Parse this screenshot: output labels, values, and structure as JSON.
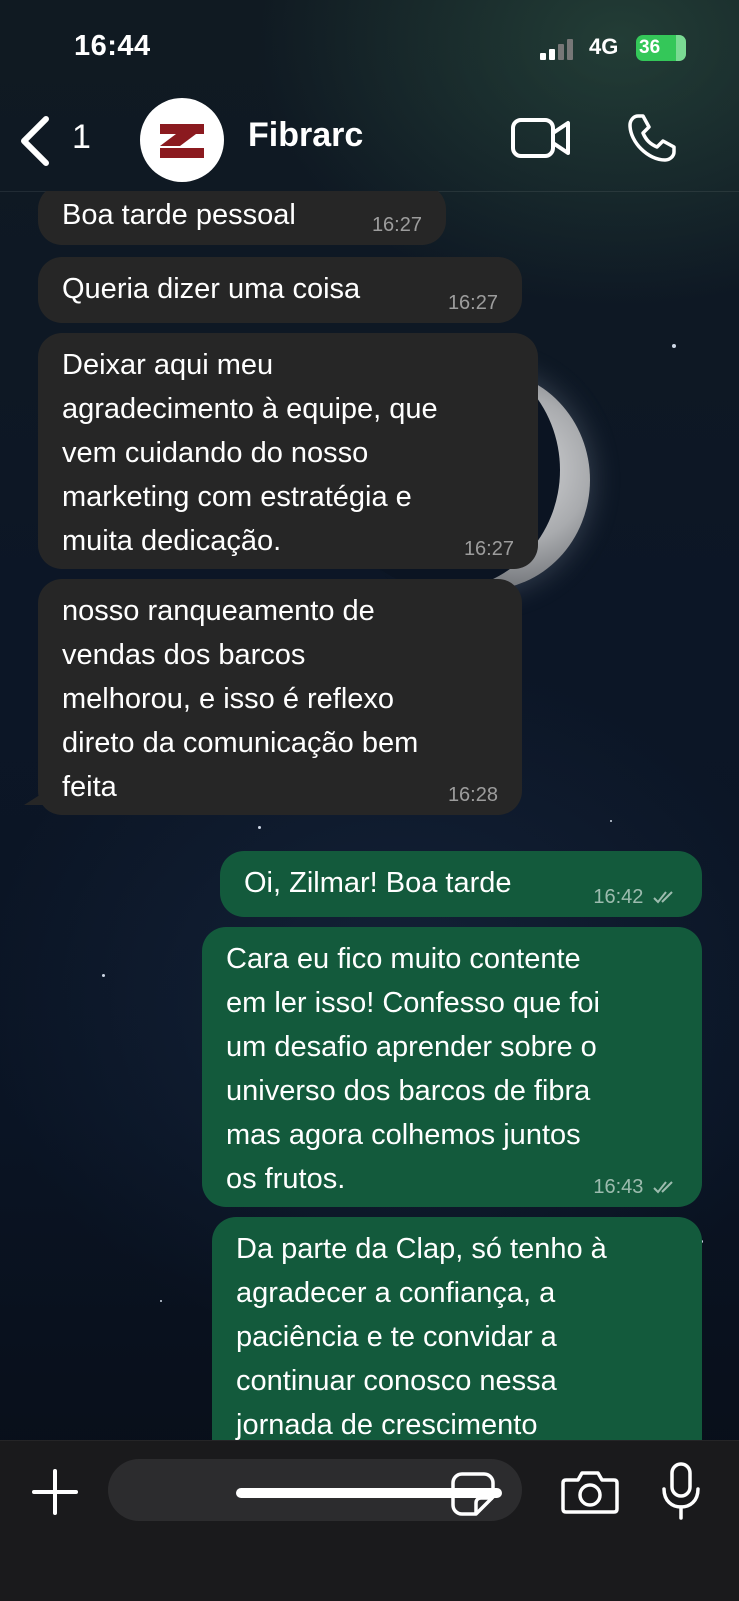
{
  "status_bar": {
    "time": "16:44",
    "network": "4G",
    "battery": "36"
  },
  "header": {
    "back_count": "1",
    "contact_name": "Fibrarc"
  },
  "messages": [
    {
      "direction": "incoming",
      "text": "Boa tarde pessoal",
      "time": "16:27"
    },
    {
      "direction": "incoming",
      "text": "Queria dizer uma coisa",
      "time": "16:27"
    },
    {
      "direction": "incoming",
      "text": "Deixar aqui meu\nagradecimento à equipe, que\nvem cuidando do nosso\nmarketing com estratégia e\nmuita dedicação.",
      "time": "16:27"
    },
    {
      "direction": "incoming",
      "text": "nosso ranqueamento de\nvendas dos barcos\nmelhorou, e isso é reflexo\ndireto da comunicação bem\nfeita",
      "time": "16:28"
    },
    {
      "direction": "outgoing",
      "text": "Oi, Zilmar! Boa tarde",
      "time": "16:42",
      "status": "read-ticks-icon"
    },
    {
      "direction": "outgoing",
      "text": "Cara eu fico muito contente\nem ler isso! Confesso que foi\num desafio aprender sobre o\nuniverso dos barcos de fibra\nmas agora colhemos juntos\nos frutos.",
      "time": "16:43",
      "status": "read-ticks-icon"
    },
    {
      "direction": "outgoing",
      "text": "Da parte da Clap, só tenho à\nagradecer a confiança, a\npaciência e te convidar a\ncontinuar conosco nessa\njornada de crescimento",
      "time": ""
    }
  ],
  "composer": {
    "placeholder": "",
    "value": ""
  },
  "colors": {
    "incoming_bubble": "#262626",
    "outgoing_bubble": "#135a3c",
    "battery": "#34c759",
    "logo_red": "#8b1a1f"
  },
  "icons": [
    "back-chevron-icon",
    "video-call-icon",
    "phone-icon",
    "plus-icon",
    "sticker-icon",
    "camera-icon",
    "microphone-icon"
  ]
}
